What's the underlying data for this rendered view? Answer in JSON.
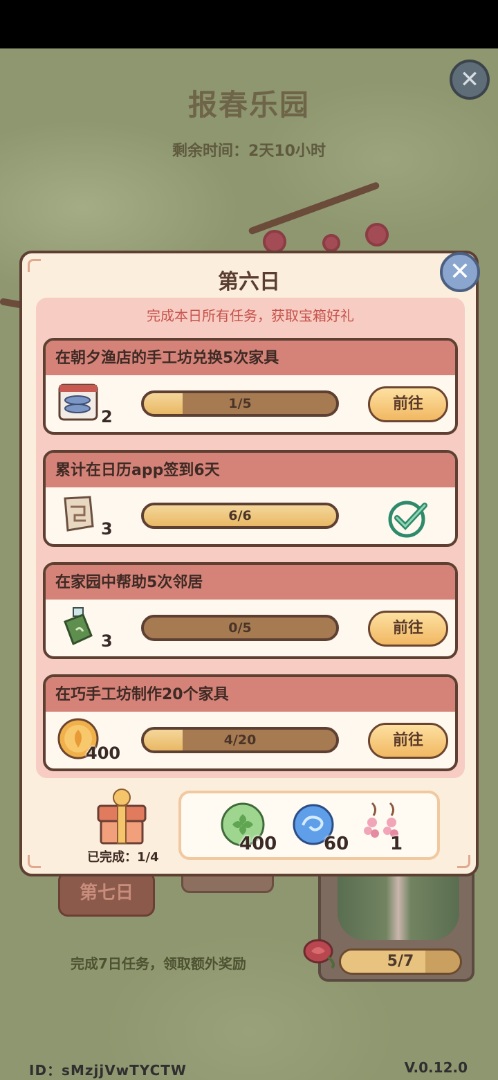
{
  "event": {
    "title": "报春乐园",
    "remaining_label": "剩余时间：2天10小时"
  },
  "modal": {
    "title": "第六日",
    "hint": "完成本日所有任务，获取宝箱好礼",
    "tasks": [
      {
        "title": "在朝夕渔店的手工坊兑换5次家具",
        "reward_icon": "fish-tray-icon",
        "reward_count": "2",
        "progress_text": "1/5",
        "progress": 0.2,
        "action": "前往",
        "done": false
      },
      {
        "title": "累计在日历app签到6天",
        "reward_icon": "map-scroll-icon",
        "reward_count": "3",
        "progress_text": "6/6",
        "progress": 1.0,
        "action": "",
        "done": true
      },
      {
        "title": "在家园中帮助5次邻居",
        "reward_icon": "spray-bottle-icon",
        "reward_count": "3",
        "progress_text": "0/5",
        "progress": 0.0,
        "action": "前往",
        "done": false
      },
      {
        "title": "在巧手工坊制作20个家具",
        "reward_icon": "gold-coin-icon",
        "reward_count": "400",
        "progress_text": "4/20",
        "progress": 0.2,
        "action": "前往",
        "done": false
      }
    ],
    "chest": {
      "completed_label": "已完成：1/4",
      "rewards": [
        {
          "icon": "green-clover-coin-icon",
          "count": "400"
        },
        {
          "icon": "blue-swirl-orb-icon",
          "count": "60"
        },
        {
          "icon": "flower-earrings-icon",
          "count": "1"
        }
      ]
    }
  },
  "background": {
    "day7_tab": "第七日",
    "bonus_note": "完成7日任务，领取额外奖励",
    "bonus_progress_text": "5/7",
    "bonus_progress": 0.71
  },
  "footer": {
    "id_label": "ID：sMzjjVwTYCTW",
    "version": "V.0.12.0"
  },
  "colors": {
    "modal_bg": "#fbeedd",
    "panel_pink": "#f6ccc3",
    "task_header": "#d58379",
    "hint_red": "#c7534c",
    "button_gold": "#f1b862"
  }
}
